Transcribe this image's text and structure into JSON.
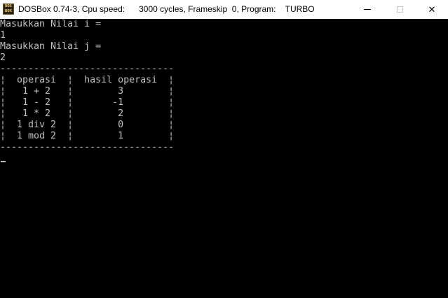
{
  "window": {
    "icon_text_top": "DOS",
    "icon_text_bottom": "BOX",
    "title": "DOSBox 0.74-3, Cpu speed:      3000 cycles, Frameskip  0, Program:    TURBO",
    "minimize_symbol": "",
    "maximize_symbol": "",
    "close_symbol": "✕"
  },
  "terminal": {
    "lines": [
      "Masukkan Nilai i =",
      "1",
      "Masukkan Nilai j =",
      "2",
      "-------------------------------",
      "¦  operasi  ¦  hasil operasi  ¦",
      "¦   1 + 2   ¦        3        ¦",
      "¦   1 - 2   ¦       -1        ¦",
      "¦   1 * 2   ¦        2        ¦",
      "¦  1 div 2  ¦        0        ¦",
      "¦  1 mod 2  ¦        1        ¦",
      "-------------------------------"
    ]
  },
  "colors": {
    "terminal_background": "#000000",
    "terminal_text": "#c0c0c0",
    "titlebar_background": "#ffffff"
  }
}
